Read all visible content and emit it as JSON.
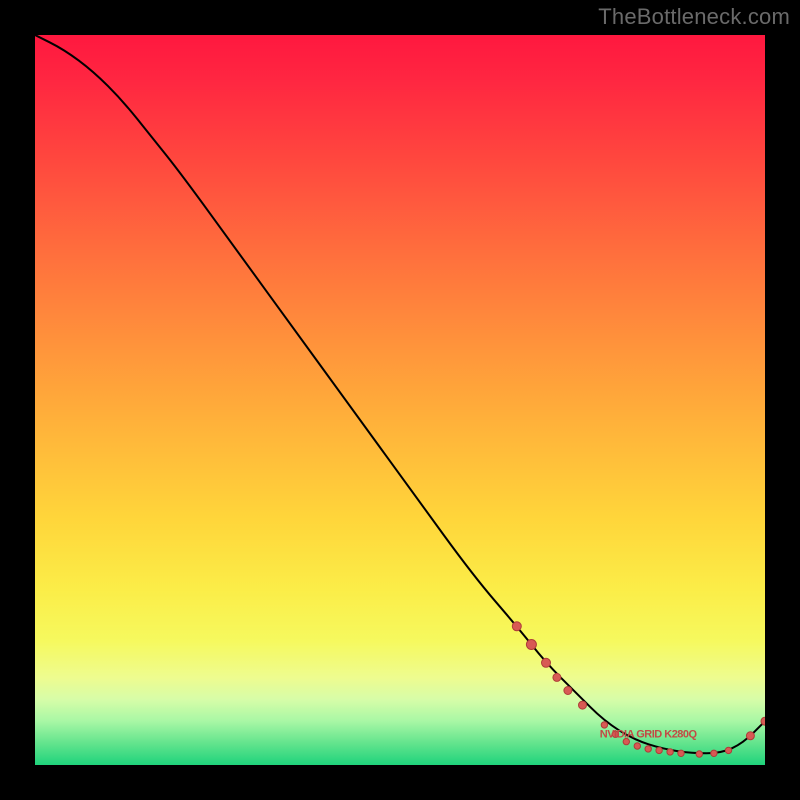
{
  "watermark": "TheBottleneck.com",
  "annotation_label": "NVIDIA GRID K280Q",
  "colors": {
    "curve": "#000000",
    "marker_fill": "#d85a54",
    "marker_stroke": "#af3d38",
    "annotation": "#c24a45"
  },
  "chart_data": {
    "type": "line",
    "title": "",
    "xlabel": "",
    "ylabel": "",
    "xlim": [
      0,
      100
    ],
    "ylim": [
      0,
      100
    ],
    "series": [
      {
        "name": "bottleneck-curve",
        "x": [
          0,
          4,
          8,
          12,
          16,
          20,
          28,
          36,
          44,
          52,
          60,
          66,
          70,
          74,
          78,
          82,
          86,
          90,
          94,
          97,
          100
        ],
        "y": [
          100,
          98,
          95,
          91,
          86,
          81,
          70,
          59,
          48,
          37,
          26,
          19,
          14,
          10,
          6,
          3.5,
          2.2,
          1.6,
          1.6,
          3,
          6
        ]
      }
    ],
    "markers": [
      {
        "x": 66,
        "y": 19,
        "r": 4.5
      },
      {
        "x": 68,
        "y": 16.5,
        "r": 5
      },
      {
        "x": 70,
        "y": 14,
        "r": 4.5
      },
      {
        "x": 71.5,
        "y": 12,
        "r": 4
      },
      {
        "x": 73,
        "y": 10.2,
        "r": 4
      },
      {
        "x": 75,
        "y": 8.2,
        "r": 4
      },
      {
        "x": 78,
        "y": 5.5,
        "r": 3.2
      },
      {
        "x": 79.5,
        "y": 4.2,
        "r": 3.2
      },
      {
        "x": 81,
        "y": 3.2,
        "r": 3.2
      },
      {
        "x": 82.5,
        "y": 2.6,
        "r": 3.2
      },
      {
        "x": 84,
        "y": 2.2,
        "r": 3.2
      },
      {
        "x": 85.5,
        "y": 2.0,
        "r": 3.2
      },
      {
        "x": 87,
        "y": 1.8,
        "r": 3.2
      },
      {
        "x": 88.5,
        "y": 1.6,
        "r": 3.2
      },
      {
        "x": 91,
        "y": 1.5,
        "r": 3.2
      },
      {
        "x": 93,
        "y": 1.6,
        "r": 3.2
      },
      {
        "x": 95,
        "y": 2.0,
        "r": 3.2
      },
      {
        "x": 98,
        "y": 4.0,
        "r": 4
      },
      {
        "x": 100,
        "y": 6.0,
        "r": 4
      }
    ],
    "annotation": {
      "x": 84,
      "y": 3.8
    }
  }
}
